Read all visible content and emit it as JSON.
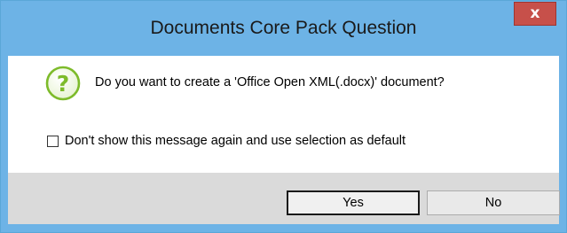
{
  "window": {
    "title": "Documents Core Pack Question",
    "close_symbol": "x"
  },
  "dialog": {
    "icon": "question-icon",
    "message": "Do you want to create a 'Office Open XML(.docx)' document?",
    "checkbox": {
      "label": "Don't show this message again and use selection as default",
      "checked": false
    }
  },
  "buttons": {
    "yes_label": "Yes",
    "no_label": "No"
  },
  "colors": {
    "titlebar": "#6db3e6",
    "close_button": "#c7504a",
    "footer": "#dadada",
    "question_icon": "#7dbb2a"
  }
}
